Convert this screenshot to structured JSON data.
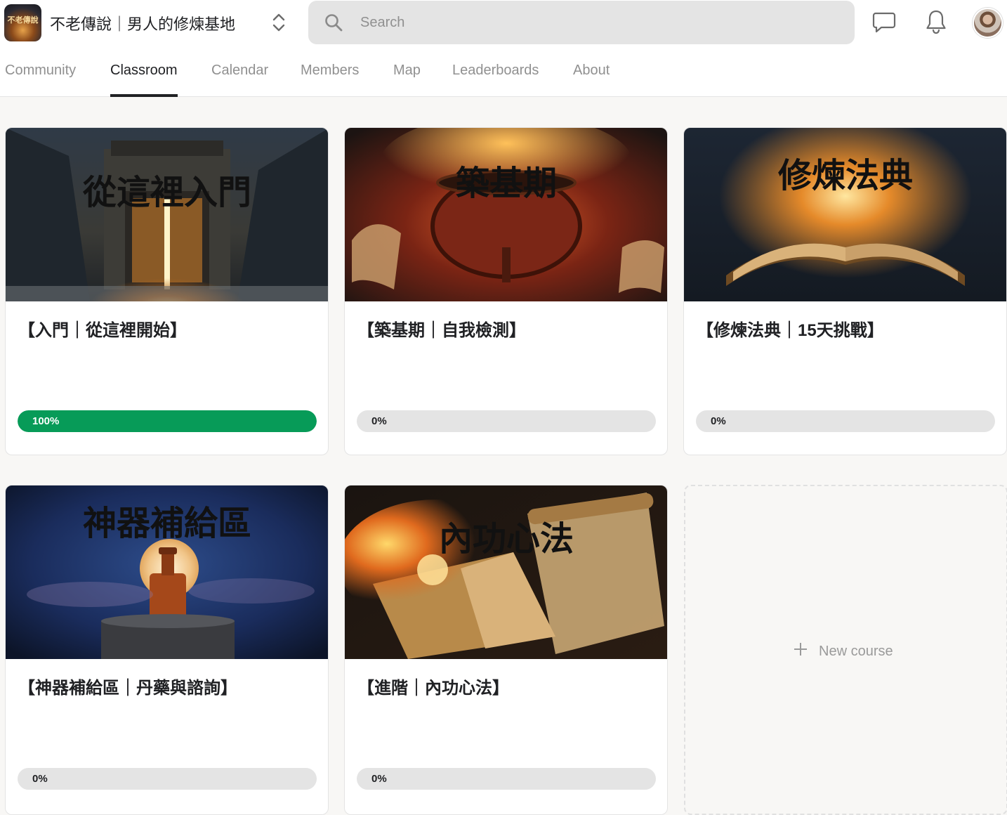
{
  "header": {
    "logo_text": "不老傳說",
    "group_name": "不老傳說｜男人的修煉基地",
    "search_placeholder": "Search"
  },
  "tabs": [
    {
      "label": "Community",
      "active": false
    },
    {
      "label": "Classroom",
      "active": true
    },
    {
      "label": "Calendar",
      "active": false
    },
    {
      "label": "Members",
      "active": false
    },
    {
      "label": "Map",
      "active": false
    },
    {
      "label": "Leaderboards",
      "active": false
    },
    {
      "label": "About",
      "active": false
    }
  ],
  "courses": [
    {
      "title": "【入門｜從這裡開始】",
      "image_title": "從這裡入門",
      "progress": 100,
      "progress_label": "100%"
    },
    {
      "title": "【築基期｜自我檢測】",
      "image_title": "築基期",
      "progress": 0,
      "progress_label": "0%"
    },
    {
      "title": "【修煉法典｜15天挑戰】",
      "image_title": "修煉法典",
      "progress": 0,
      "progress_label": "0%"
    },
    {
      "title": "【神器補給區｜丹藥與諮詢】",
      "image_title": "神器補給區",
      "progress": 0,
      "progress_label": "0%"
    },
    {
      "title": "【進階｜內功心法】",
      "image_title": "內功心法",
      "progress": 0,
      "progress_label": "0%"
    }
  ],
  "new_course_label": "New course",
  "colors": {
    "progress_fill": "#079b58",
    "progress_track": "#e4e4e4"
  }
}
